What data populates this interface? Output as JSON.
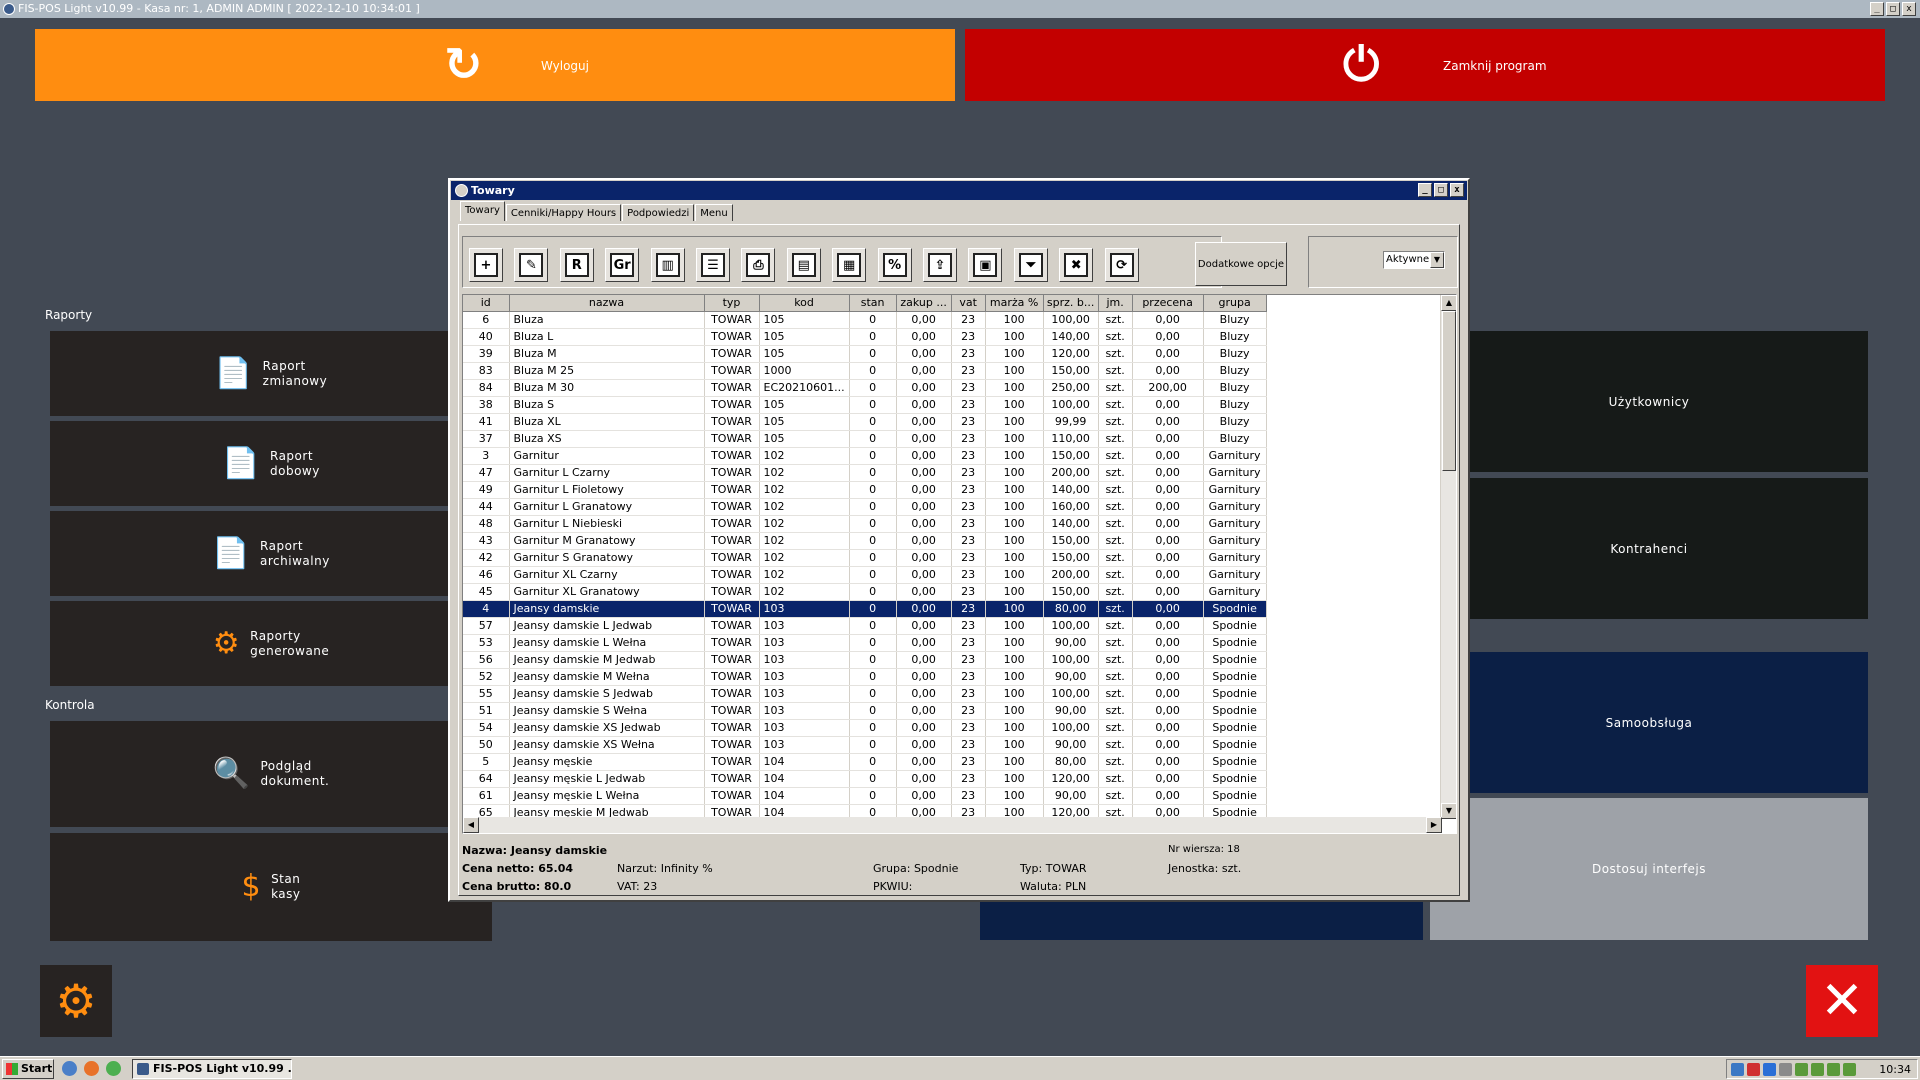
{
  "titlebar": {
    "text": "FIS-POS Light v10.99 - Kasa nr: 1, ADMIN ADMIN [ 2022-12-10 10:34:01 ]",
    "min": "_",
    "max": "□",
    "close": "x"
  },
  "top_buttons": {
    "logout": "Wyloguj",
    "close_program": "Zamknij program"
  },
  "sections": {
    "reports": "Raporty",
    "control": "Kontrola"
  },
  "left_tiles": [
    {
      "line1": "Raport",
      "line2": "zmianowy"
    },
    {
      "line1": "Raport",
      "line2": "dobowy"
    },
    {
      "line1": "Raport",
      "line2": "archiwalny"
    },
    {
      "line1": "Raporty",
      "line2": "generowane"
    },
    {
      "line1": "Podgląd",
      "line2": "dokument."
    },
    {
      "line1": "Stan",
      "line2": "kasy"
    }
  ],
  "right_tiles": {
    "users": "Użytkownicy",
    "contractors": "Kontrahenci",
    "self_service": "Samoobsługa",
    "customize": "Dostosuj interfejs"
  },
  "dialog": {
    "title": "Towary",
    "tabs": [
      "Towary",
      "Cenniki/Happy Hours",
      "Podpowiedzi",
      "Menu"
    ],
    "more_options": "Dodatkowe opcje",
    "status_filter": "Aktywne",
    "toolbar_icons": [
      "add-icon",
      "edit-icon",
      "r-icon",
      "gr-icon",
      "barcode-icon",
      "list-settings-icon",
      "printer-icon",
      "scale-icon",
      "cash-register-icon",
      "percent-icon",
      "export-icon",
      "save-icon",
      "filter-icon",
      "clear-filter-icon",
      "refresh-icon"
    ],
    "toolbar_glyphs": [
      "+",
      "✎",
      "R",
      "Gr",
      "▥",
      "☰",
      "⎙",
      "▤",
      "▦",
      "%",
      "⇪",
      "▣",
      "⏷",
      "✖",
      "⟳"
    ],
    "columns": [
      "id",
      "nazwa",
      "typ",
      "kod",
      "stan",
      "zakup ...",
      "vat",
      "marża %",
      "sprz. b...",
      "jm.",
      "przecena",
      "grupa"
    ],
    "rows": [
      [
        "6",
        "Bluza",
        "TOWAR",
        "105",
        "0",
        "0,00",
        "23",
        "100",
        "100,00",
        "szt.",
        "0,00",
        "Bluzy"
      ],
      [
        "40",
        "Bluza L",
        "TOWAR",
        "105",
        "0",
        "0,00",
        "23",
        "100",
        "140,00",
        "szt.",
        "0,00",
        "Bluzy"
      ],
      [
        "39",
        "Bluza M",
        "TOWAR",
        "105",
        "0",
        "0,00",
        "23",
        "100",
        "120,00",
        "szt.",
        "0,00",
        "Bluzy"
      ],
      [
        "83",
        "Bluza M 25",
        "TOWAR",
        "1000",
        "0",
        "0,00",
        "23",
        "100",
        "150,00",
        "szt.",
        "0,00",
        "Bluzy"
      ],
      [
        "84",
        "Bluza M 30",
        "TOWAR",
        "EC20210601...",
        "0",
        "0,00",
        "23",
        "100",
        "250,00",
        "szt.",
        "200,00",
        "Bluzy"
      ],
      [
        "38",
        "Bluza S",
        "TOWAR",
        "105",
        "0",
        "0,00",
        "23",
        "100",
        "100,00",
        "szt.",
        "0,00",
        "Bluzy"
      ],
      [
        "41",
        "Bluza XL",
        "TOWAR",
        "105",
        "0",
        "0,00",
        "23",
        "100",
        "99,99",
        "szt.",
        "0,00",
        "Bluzy"
      ],
      [
        "37",
        "Bluza XS",
        "TOWAR",
        "105",
        "0",
        "0,00",
        "23",
        "100",
        "110,00",
        "szt.",
        "0,00",
        "Bluzy"
      ],
      [
        "3",
        "Garnitur",
        "TOWAR",
        "102",
        "0",
        "0,00",
        "23",
        "100",
        "150,00",
        "szt.",
        "0,00",
        "Garnitury"
      ],
      [
        "47",
        "Garnitur L Czarny",
        "TOWAR",
        "102",
        "0",
        "0,00",
        "23",
        "100",
        "200,00",
        "szt.",
        "0,00",
        "Garnitury"
      ],
      [
        "49",
        "Garnitur L Fioletowy",
        "TOWAR",
        "102",
        "0",
        "0,00",
        "23",
        "100",
        "140,00",
        "szt.",
        "0,00",
        "Garnitury"
      ],
      [
        "44",
        "Garnitur L Granatowy",
        "TOWAR",
        "102",
        "0",
        "0,00",
        "23",
        "100",
        "160,00",
        "szt.",
        "0,00",
        "Garnitury"
      ],
      [
        "48",
        "Garnitur L Niebieski",
        "TOWAR",
        "102",
        "0",
        "0,00",
        "23",
        "100",
        "140,00",
        "szt.",
        "0,00",
        "Garnitury"
      ],
      [
        "43",
        "Garnitur M Granatowy",
        "TOWAR",
        "102",
        "0",
        "0,00",
        "23",
        "100",
        "150,00",
        "szt.",
        "0,00",
        "Garnitury"
      ],
      [
        "42",
        "Garnitur S Granatowy",
        "TOWAR",
        "102",
        "0",
        "0,00",
        "23",
        "100",
        "150,00",
        "szt.",
        "0,00",
        "Garnitury"
      ],
      [
        "46",
        "Garnitur XL Czarny",
        "TOWAR",
        "102",
        "0",
        "0,00",
        "23",
        "100",
        "200,00",
        "szt.",
        "0,00",
        "Garnitury"
      ],
      [
        "45",
        "Garnitur XL Granatowy",
        "TOWAR",
        "102",
        "0",
        "0,00",
        "23",
        "100",
        "150,00",
        "szt.",
        "0,00",
        "Garnitury"
      ],
      [
        "4",
        "Jeansy damskie",
        "TOWAR",
        "103",
        "0",
        "0,00",
        "23",
        "100",
        "80,00",
        "szt.",
        "0,00",
        "Spodnie"
      ],
      [
        "57",
        "Jeansy damskie L Jedwab",
        "TOWAR",
        "103",
        "0",
        "0,00",
        "23",
        "100",
        "100,00",
        "szt.",
        "0,00",
        "Spodnie"
      ],
      [
        "53",
        "Jeansy damskie L Wełna",
        "TOWAR",
        "103",
        "0",
        "0,00",
        "23",
        "100",
        "90,00",
        "szt.",
        "0,00",
        "Spodnie"
      ],
      [
        "56",
        "Jeansy damskie M Jedwab",
        "TOWAR",
        "103",
        "0",
        "0,00",
        "23",
        "100",
        "100,00",
        "szt.",
        "0,00",
        "Spodnie"
      ],
      [
        "52",
        "Jeansy damskie M Wełna",
        "TOWAR",
        "103",
        "0",
        "0,00",
        "23",
        "100",
        "90,00",
        "szt.",
        "0,00",
        "Spodnie"
      ],
      [
        "55",
        "Jeansy damskie S Jedwab",
        "TOWAR",
        "103",
        "0",
        "0,00",
        "23",
        "100",
        "100,00",
        "szt.",
        "0,00",
        "Spodnie"
      ],
      [
        "51",
        "Jeansy damskie S Wełna",
        "TOWAR",
        "103",
        "0",
        "0,00",
        "23",
        "100",
        "90,00",
        "szt.",
        "0,00",
        "Spodnie"
      ],
      [
        "54",
        "Jeansy damskie XS Jedwab",
        "TOWAR",
        "103",
        "0",
        "0,00",
        "23",
        "100",
        "100,00",
        "szt.",
        "0,00",
        "Spodnie"
      ],
      [
        "50",
        "Jeansy damskie XS Wełna",
        "TOWAR",
        "103",
        "0",
        "0,00",
        "23",
        "100",
        "90,00",
        "szt.",
        "0,00",
        "Spodnie"
      ],
      [
        "5",
        "Jeansy męskie",
        "TOWAR",
        "104",
        "0",
        "0,00",
        "23",
        "100",
        "80,00",
        "szt.",
        "0,00",
        "Spodnie"
      ],
      [
        "64",
        "Jeansy męskie L Jedwab",
        "TOWAR",
        "104",
        "0",
        "0,00",
        "23",
        "100",
        "120,00",
        "szt.",
        "0,00",
        "Spodnie"
      ],
      [
        "61",
        "Jeansy męskie L Wełna",
        "TOWAR",
        "104",
        "0",
        "0,00",
        "23",
        "100",
        "90,00",
        "szt.",
        "0,00",
        "Spodnie"
      ],
      [
        "65",
        "Jeansy męskie M Jedwab",
        "TOWAR",
        "104",
        "0",
        "0,00",
        "23",
        "100",
        "120,00",
        "szt.",
        "0,00",
        "Spodnie"
      ]
    ],
    "selected_row": 17,
    "info": {
      "name": "Nazwa: Jeansy damskie",
      "net": "Cena netto: 65.04",
      "gross": "Cena brutto: 80.0",
      "markup": "Narzut: Infinity %",
      "vat": "VAT: 23",
      "group": "Grupa: Spodnie",
      "pkwiu": "PKWIU:",
      "type": "Typ: TOWAR",
      "currency": "Waluta: PLN",
      "row_no": "Nr wiersza: 18",
      "unit": "Jenostka: szt."
    }
  },
  "taskbar": {
    "start": "Start",
    "task": "FIS-POS Light v10.99 ...",
    "clock": "10:34"
  },
  "colors": {
    "orange": "#ff8d10",
    "red": "#c30000",
    "bg": "#424954",
    "tile": "#272322",
    "navy": "#0b1f45",
    "grey": "#9ea2a8",
    "selection": "#0a246a"
  }
}
